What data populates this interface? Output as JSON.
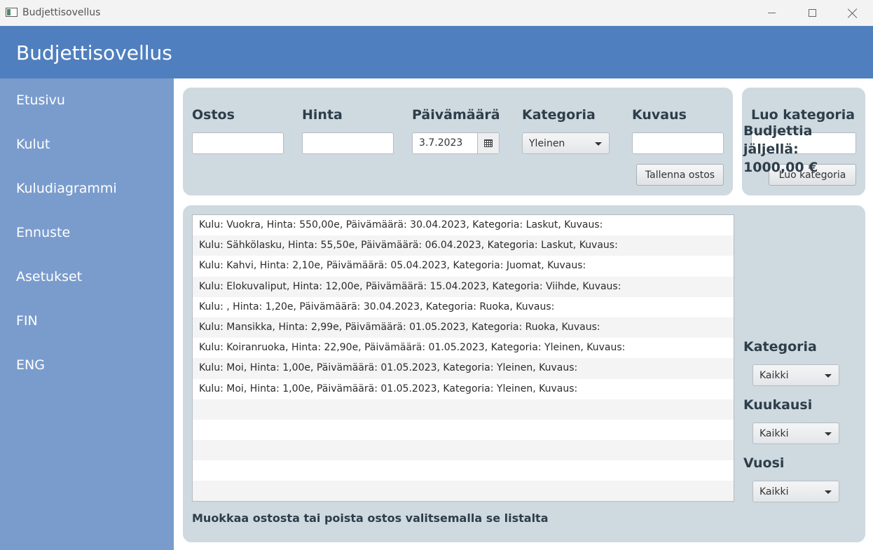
{
  "window": {
    "title": "Budjettisovellus",
    "icons": {
      "app": "app-window-icon",
      "minimize": "minimize-icon",
      "maximize": "maximize-icon",
      "close": "close-icon"
    }
  },
  "header": {
    "title": "Budjettisovellus"
  },
  "sidebar": {
    "items": [
      {
        "label": "Etusivu"
      },
      {
        "label": "Kulut"
      },
      {
        "label": "Kuludiagrammi"
      },
      {
        "label": "Ennuste"
      },
      {
        "label": "Asetukset"
      },
      {
        "label": "FIN"
      },
      {
        "label": "ENG"
      }
    ]
  },
  "form": {
    "purchase_label": "Ostos",
    "purchase_value": "",
    "price_label": "Hinta",
    "price_value": "",
    "date_label": "Päivämäärä",
    "date_value": "3.7.2023",
    "category_label": "Kategoria",
    "category_value": "Yleinen",
    "description_label": "Kuvaus",
    "description_value": "",
    "save_button": "Tallenna ostos",
    "calendar_icon": "calendar-icon"
  },
  "create_category": {
    "label": "Luo kategoria",
    "value": "",
    "button": "Luo kategoria"
  },
  "expenses": {
    "rows": [
      "Kulu: Vuokra, Hinta: 550,00e, Päivämäärä: 30.04.2023, Kategoria: Laskut, Kuvaus:",
      "Kulu: Sähkölasku, Hinta: 55,50e, Päivämäärä: 06.04.2023, Kategoria: Laskut, Kuvaus:",
      "Kulu: Kahvi, Hinta: 2,10e, Päivämäärä: 05.04.2023, Kategoria: Juomat, Kuvaus:",
      "Kulu: Elokuvaliput, Hinta: 12,00e, Päivämäärä: 15.04.2023, Kategoria: Viihde, Kuvaus:",
      "Kulu: , Hinta: 1,20e, Päivämäärä: 30.04.2023, Kategoria: Ruoka, Kuvaus:",
      "Kulu: Mansikka, Hinta: 2,99e, Päivämäärä: 01.05.2023, Kategoria: Ruoka, Kuvaus:",
      "Kulu: Koiranruoka, Hinta: 22,90e, Päivämäärä: 01.05.2023, Kategoria: Yleinen, Kuvaus:",
      "Kulu: Moi, Hinta: 1,00e, Päivämäärä: 01.05.2023, Kategoria: Yleinen, Kuvaus:",
      "Kulu: Moi, Hinta: 1,00e, Päivämäärä: 01.05.2023, Kategoria: Yleinen, Kuvaus:"
    ],
    "hint": "Muokkaa ostosta tai poista ostos valitsemalla se listalta"
  },
  "budget": {
    "line1": "Budjettia",
    "line2": "jäljellä:",
    "amount": "1000,00 €"
  },
  "filters": {
    "category_label": "Kategoria",
    "category_value": "Kaikki",
    "month_label": "Kuukausi",
    "month_value": "Kaikki",
    "year_label": "Vuosi",
    "year_value": "Kaikki"
  }
}
